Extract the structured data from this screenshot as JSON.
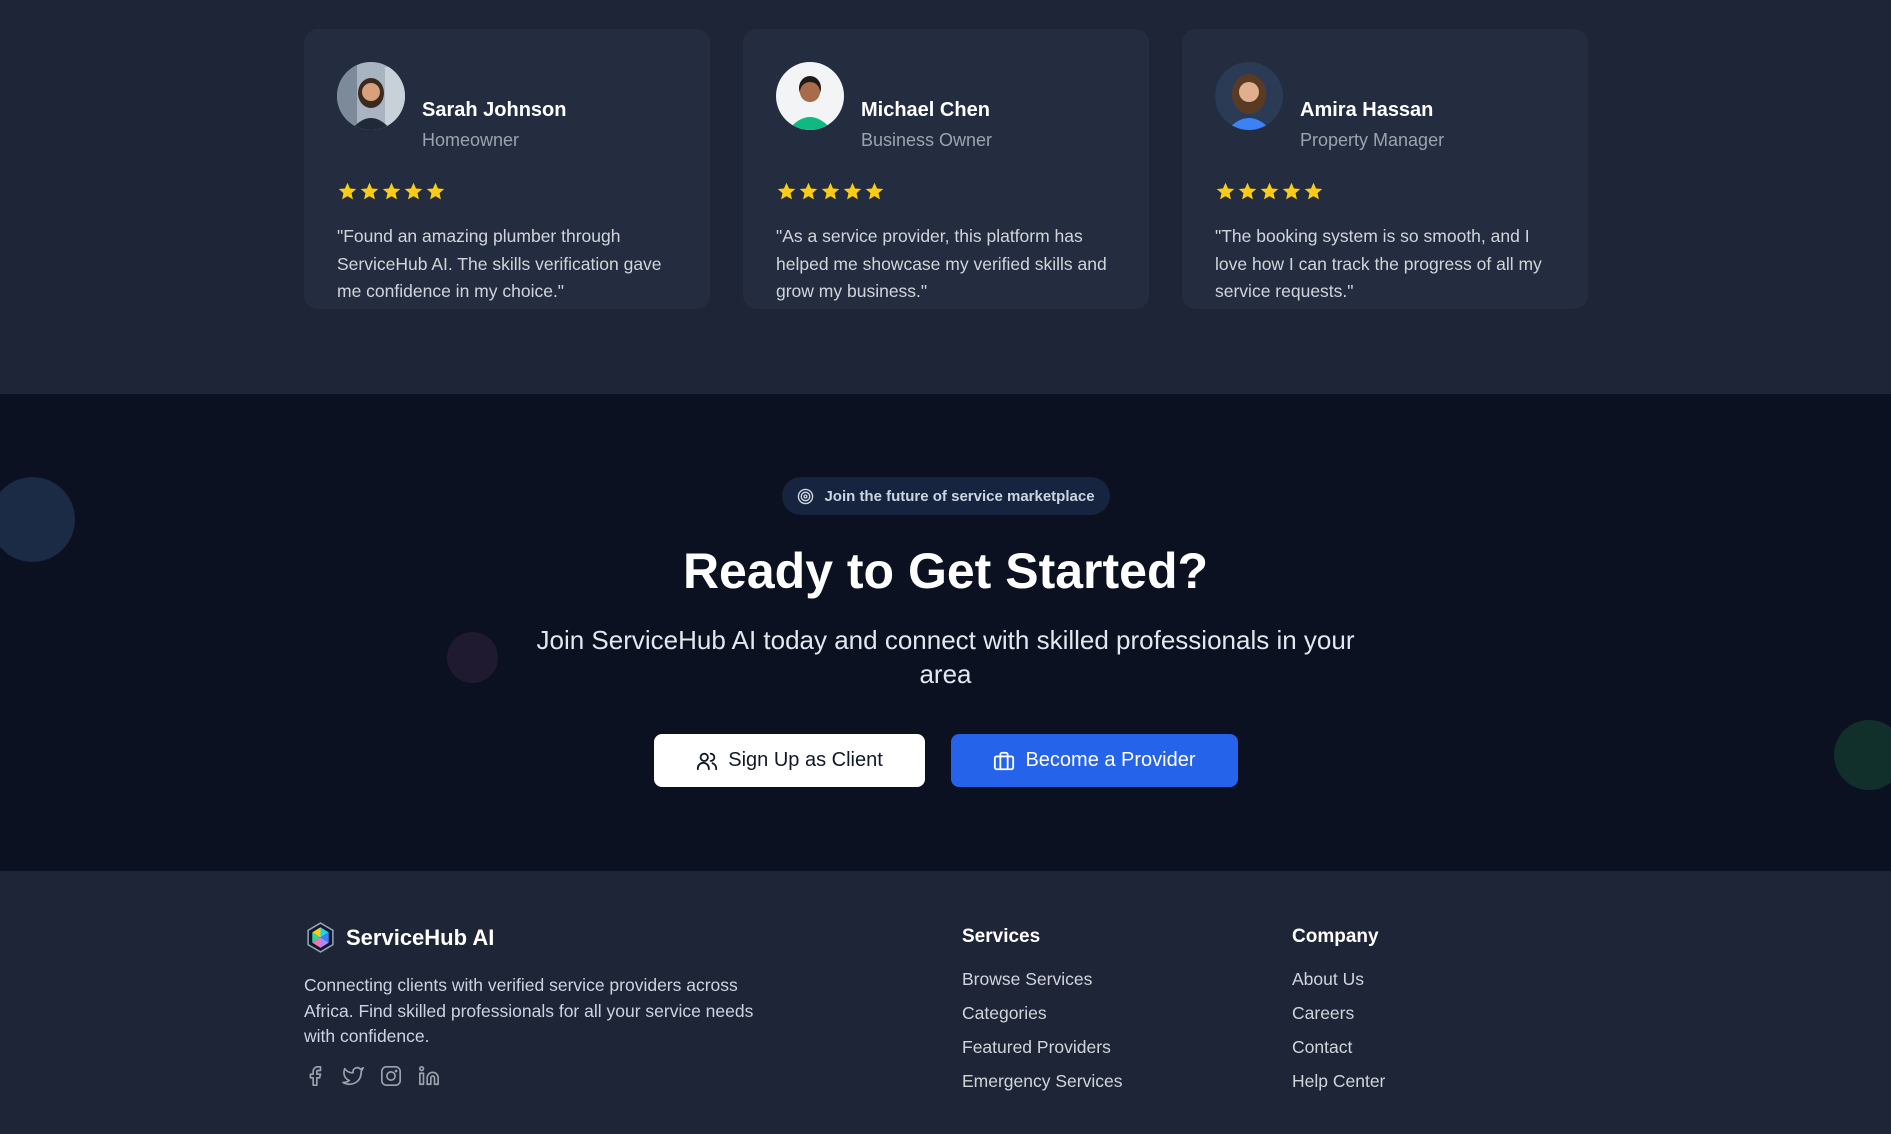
{
  "testimonials": [
    {
      "name": "Sarah Johnson",
      "role": "Homeowner",
      "rating": 5,
      "quote": "\"Found an amazing plumber through ServiceHub AI. The skills verification gave me confidence in my choice.\""
    },
    {
      "name": "Michael Chen",
      "role": "Business Owner",
      "rating": 5,
      "quote": "\"As a service provider, this platform has helped me showcase my verified skills and grow my business.\""
    },
    {
      "name": "Amira Hassan",
      "role": "Property Manager",
      "rating": 5,
      "quote": "\"The booking system is so smooth, and I love how I can track the progress of all my service requests.\""
    }
  ],
  "cta": {
    "badge": "Join the future of service marketplace",
    "title": "Ready to Get Started?",
    "subtitle": "Join ServiceHub AI today and connect with skilled professionals in your area",
    "client_button": "Sign Up as Client",
    "provider_button": "Become a Provider"
  },
  "footer": {
    "brand": "ServiceHub AI",
    "description": "Connecting clients with verified service providers across Africa. Find skilled professionals for all your service needs with confidence.",
    "services": {
      "title": "Services",
      "links": [
        "Browse Services",
        "Categories",
        "Featured Providers",
        "Emergency Services"
      ]
    },
    "company": {
      "title": "Company",
      "links": [
        "About Us",
        "Careers",
        "Contact",
        "Help Center"
      ]
    },
    "socials": [
      "facebook-icon",
      "twitter-icon",
      "instagram-icon",
      "linkedin-icon"
    ]
  },
  "colors": {
    "accent": "#2563eb",
    "star": "#facc15",
    "cta_background": "#0b1120",
    "section_background": "#1d2536",
    "card_background": "#242d3f"
  }
}
